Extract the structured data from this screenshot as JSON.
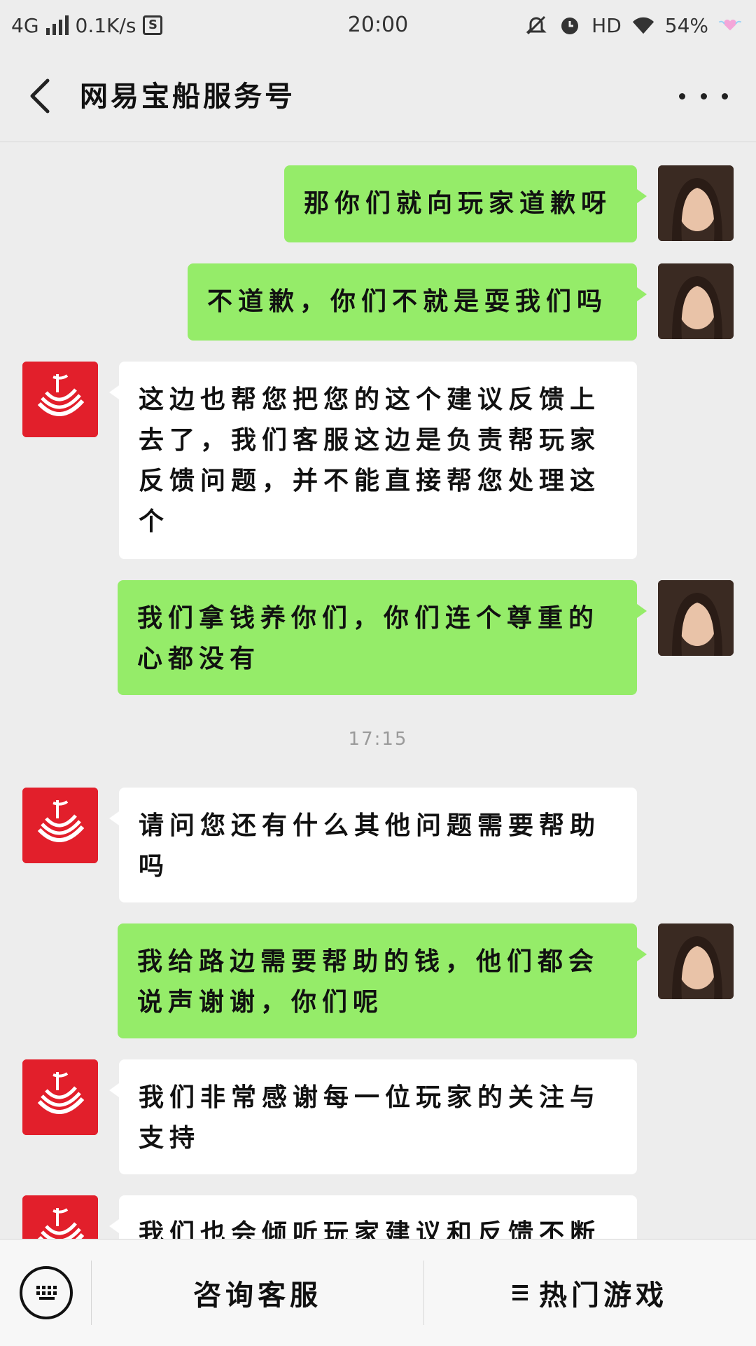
{
  "status_bar": {
    "network": "4G",
    "speed": "0.1K/s",
    "time": "20:00",
    "hd": "HD",
    "battery": "54%"
  },
  "header": {
    "back_icon": "chevron-left-icon",
    "title": "网易宝船服务号",
    "more_icon": "more-dots-icon"
  },
  "messages": [
    {
      "from": "user",
      "text": "那你们就向玩家道歉呀"
    },
    {
      "from": "user",
      "text": "不道歉，你们不就是耍我们吗"
    },
    {
      "from": "official",
      "text": "这边也帮您把您的这个建议反馈上去了，我们客服这边是负责帮玩家反馈问题，并不能直接帮您处理这个"
    },
    {
      "from": "user",
      "text": "我们拿钱养你们，你们连个尊重的心都没有"
    },
    {
      "from": "official",
      "text": "请问您还有什么其他问题需要帮助吗"
    },
    {
      "from": "user",
      "text": "我给路边需要帮助的钱，他们都会说声谢谢，你们呢"
    },
    {
      "from": "official",
      "text": "我们非常感谢每一位玩家的关注与支持"
    },
    {
      "from": "official",
      "text": "我们也会倾听玩家建议和反馈不断"
    }
  ],
  "timestamp": "17:15",
  "bottom_bar": {
    "keyboard_icon": "keyboard-icon",
    "menu1": "咨询客服",
    "menu2": "热门游戏",
    "menu2_icon": "hamburger-icon"
  },
  "colors": {
    "background": "#ededed",
    "user_bubble": "#95ec69",
    "official_bubble": "#ffffff",
    "official_avatar": "#e21f2b"
  }
}
